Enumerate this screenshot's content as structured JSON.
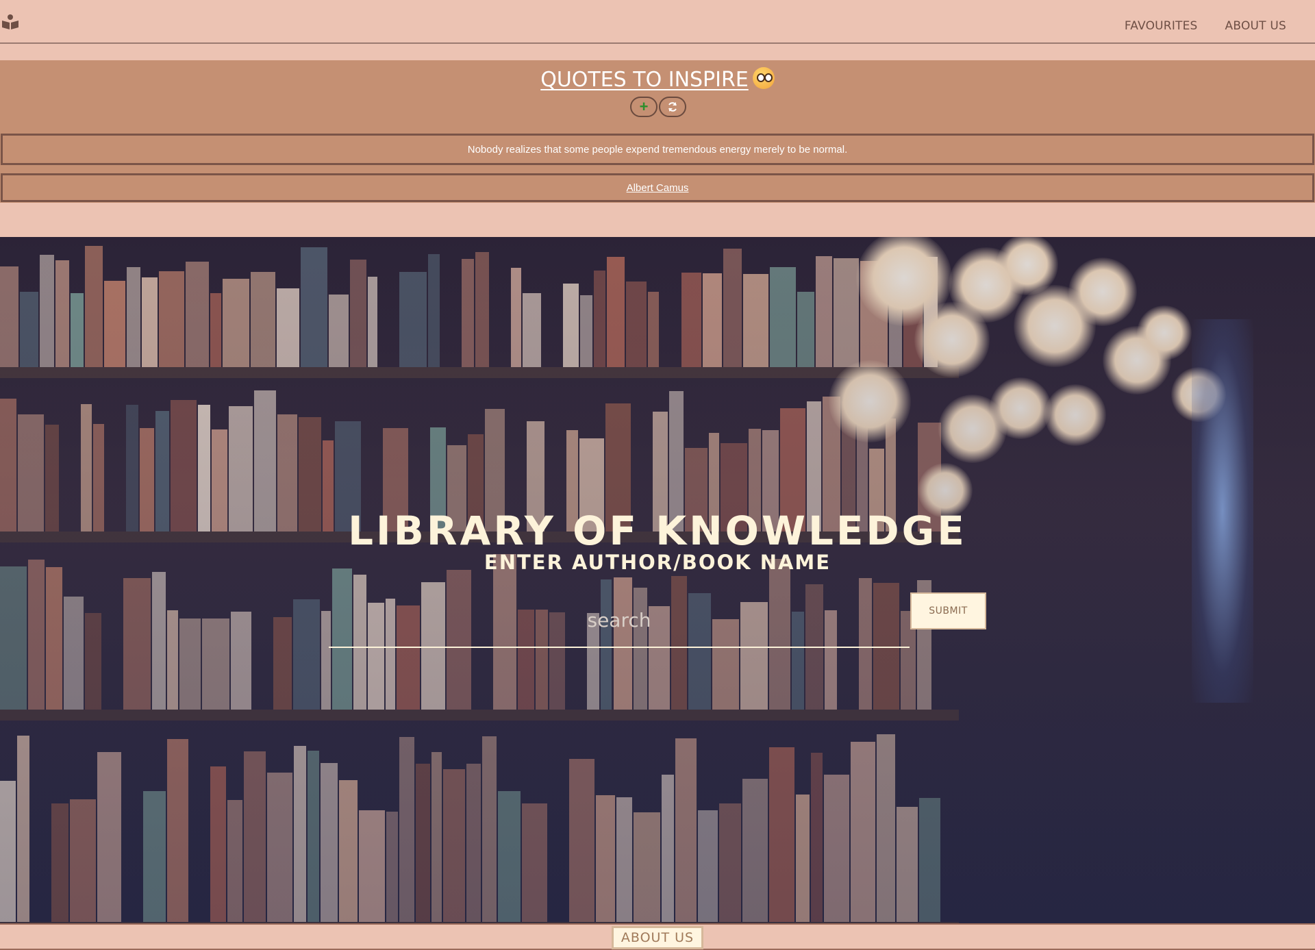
{
  "navbar": {
    "brand_icon": "book-reader-icon",
    "links": [
      "FAVOURITES",
      "ABOUT US"
    ]
  },
  "quotes": {
    "title": "QUOTES TO INSPIRE",
    "title_emoji_icon": "thinking-face-emoji",
    "add_icon": "plus-icon",
    "refresh_icon": "refresh-icon",
    "quote_text": "Nobody realizes that some people expend tremendous energy merely to be normal.",
    "author": "Albert Camus"
  },
  "hero": {
    "background": "library-bookshelves-photo",
    "title": "LIBRARY OF KNOWLEDGE",
    "subtitle": "ENTER AUTHOR/BOOK NAME",
    "search_placeholder": "search",
    "submit_label": "SUBMIT"
  },
  "footer": {
    "about_label": "ABOUT US"
  },
  "colors": {
    "page_bg": "#ecc3b3",
    "quote_bg": "#c59073",
    "hero_text": "#fdf3da",
    "button_bg": "#fff5e0",
    "add_icon_color": "#2c8f2c"
  }
}
